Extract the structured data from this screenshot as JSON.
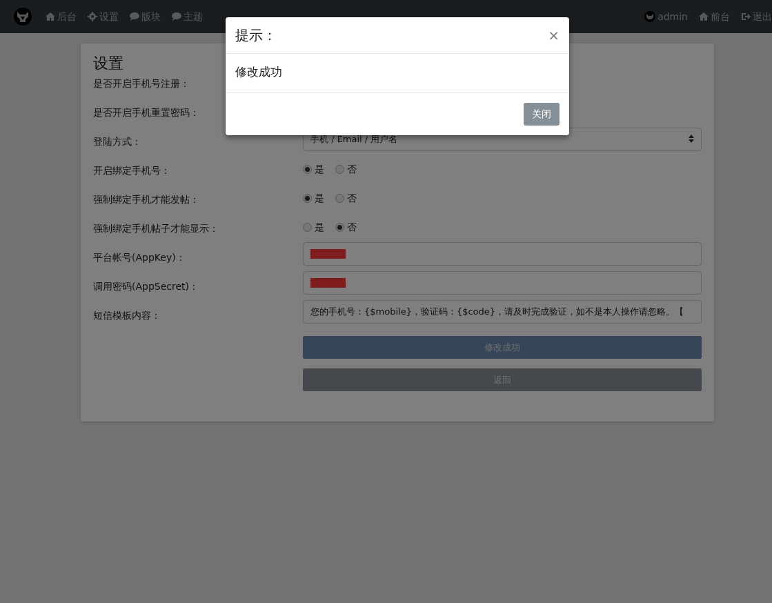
{
  "navbar": {
    "left_items": [
      {
        "kind": "home",
        "label": "后台"
      },
      {
        "kind": "gear",
        "label": "设置"
      },
      {
        "kind": "comment",
        "label": "版块"
      },
      {
        "kind": "comment",
        "label": "主题"
      }
    ],
    "right_items": [
      {
        "kind": "avatar",
        "label": "admin"
      },
      {
        "kind": "home",
        "label": "前台"
      },
      {
        "kind": "signout",
        "label": "退出"
      }
    ]
  },
  "card": {
    "title": "设置",
    "rows": [
      {
        "kind": "hidden",
        "label": "是否开启手机号注册："
      },
      {
        "kind": "hidden",
        "label": "是否开启手机重置密码："
      },
      {
        "kind": "select",
        "label": "登陆方式：",
        "value": "手机 / Email / 用户名"
      },
      {
        "kind": "radio",
        "label": "开启绑定手机号：",
        "options": [
          {
            "label": "是",
            "selected": true
          },
          {
            "label": "否",
            "selected": false
          }
        ]
      },
      {
        "kind": "radio",
        "label": "强制绑定手机才能发帖：",
        "options": [
          {
            "label": "是",
            "selected": true
          },
          {
            "label": "否",
            "selected": false
          }
        ]
      },
      {
        "kind": "radio",
        "label": "强制绑定手机帖子才能显示：",
        "options": [
          {
            "label": "是",
            "selected": false
          },
          {
            "label": "否",
            "selected": true
          }
        ]
      },
      {
        "kind": "redacted",
        "label": "平台帐号(AppKey)："
      },
      {
        "kind": "redacted",
        "label": "调用密码(AppSecret)："
      },
      {
        "kind": "text",
        "label": "短信模板内容：",
        "value": "您的手机号：{$mobile}，验证码：{$code}，请及时完成验证，如不是本人操作请忽略。【"
      }
    ],
    "buttons": [
      {
        "kind": "primary",
        "label": "修改成功"
      },
      {
        "kind": "secondary",
        "label": "返回"
      }
    ]
  },
  "modal": {
    "title": "提示：",
    "close": "×",
    "body": "修改成功",
    "button": "关闭"
  }
}
